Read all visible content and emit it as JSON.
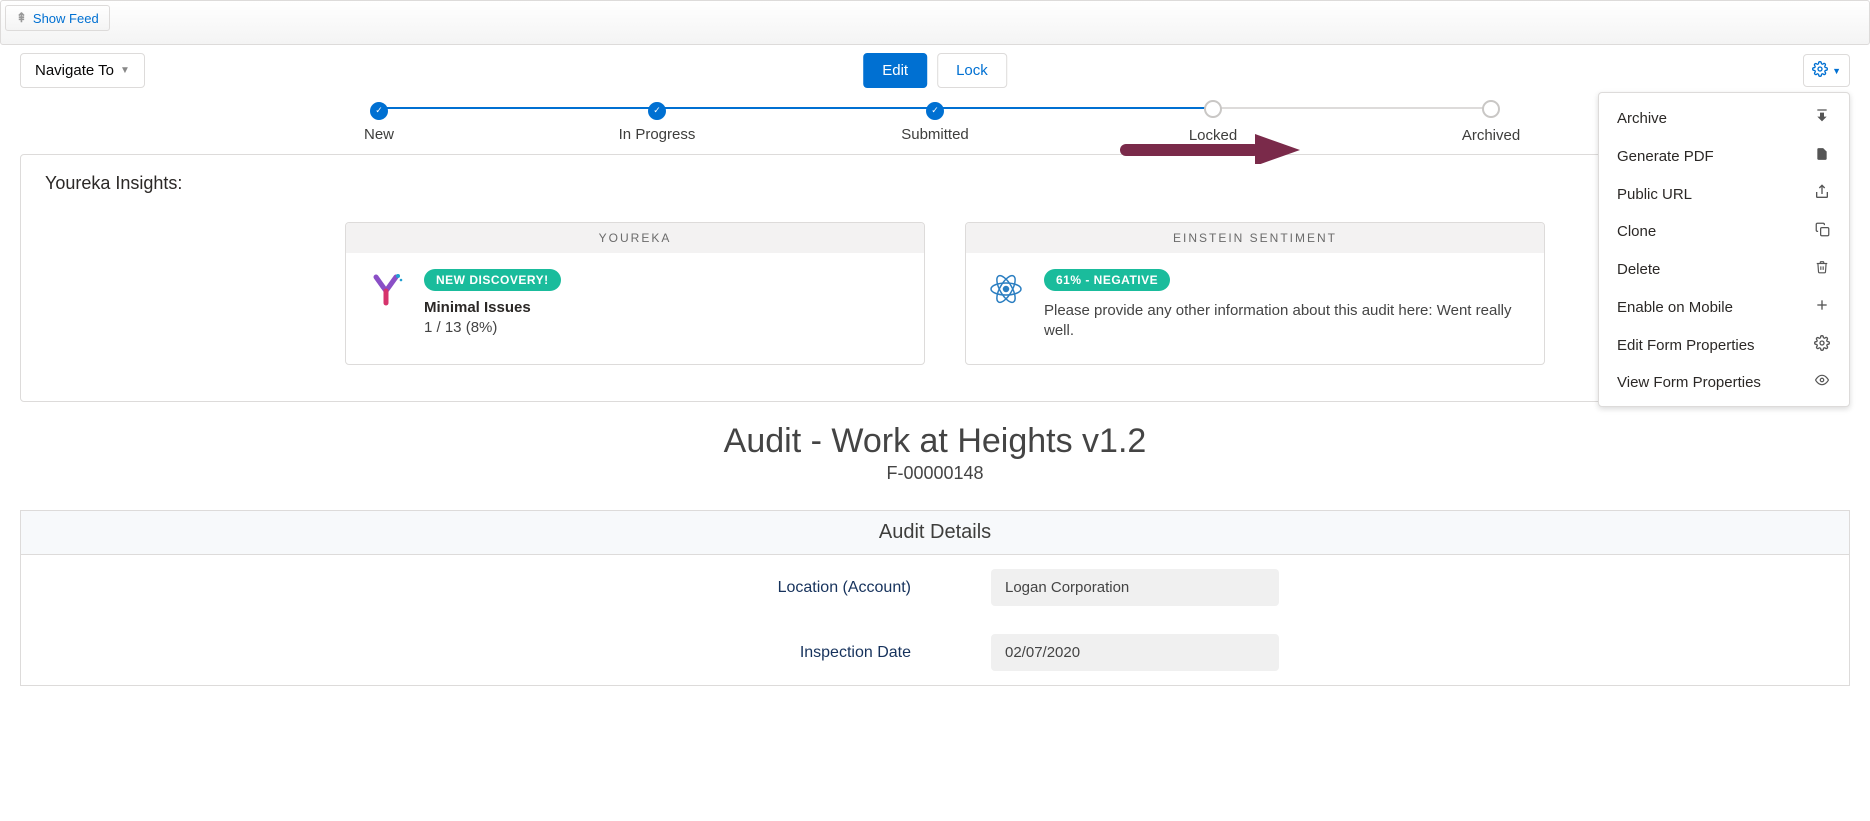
{
  "feed_toggle_label": "Show Feed",
  "nav_to_label": "Navigate To",
  "buttons": {
    "edit": "Edit",
    "lock": "Lock"
  },
  "path_steps": [
    {
      "label": "New",
      "state": "done"
    },
    {
      "label": "In Progress",
      "state": "done"
    },
    {
      "label": "Submitted",
      "state": "done"
    },
    {
      "label": "Locked",
      "state": "pending"
    },
    {
      "label": "Archived",
      "state": "pending"
    }
  ],
  "insights_heading": "Youreka Insights:",
  "insight_cards": [
    {
      "header": "YOUREKA",
      "pill": "NEW DISCOVERY!",
      "title": "Minimal Issues",
      "detail": "1 / 13 (8%)",
      "icon": "youreka"
    },
    {
      "header": "EINSTEIN SENTIMENT",
      "pill": "61% - NEGATIVE",
      "title": "",
      "detail": "Please provide any other information about this audit here: Went really well.",
      "icon": "einstein"
    }
  ],
  "page_title": "Audit - Work at Heights v1.2",
  "page_subtitle": "F-00000148",
  "details": {
    "section_title": "Audit Details",
    "fields": [
      {
        "label": "Location (Account)",
        "value": "Logan Corporation"
      },
      {
        "label": "Inspection Date",
        "value": "02/07/2020"
      }
    ]
  },
  "gear_menu": [
    {
      "label": "Archive",
      "icon": "download-icon"
    },
    {
      "label": "Generate PDF",
      "icon": "file-icon"
    },
    {
      "label": "Public URL",
      "icon": "share-icon"
    },
    {
      "label": "Clone",
      "icon": "copy-icon"
    },
    {
      "label": "Delete",
      "icon": "trash-icon"
    },
    {
      "label": "Enable on Mobile",
      "icon": "plus-icon"
    },
    {
      "label": "Edit Form Properties",
      "icon": "gear-icon"
    },
    {
      "label": "View Form Properties",
      "icon": "eye-icon"
    }
  ]
}
